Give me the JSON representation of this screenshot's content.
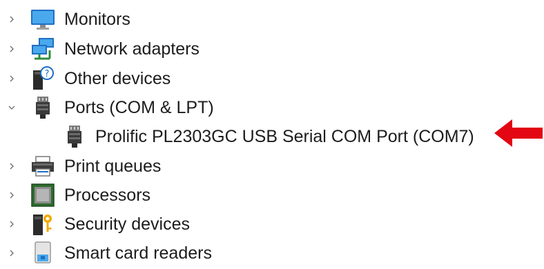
{
  "tree": {
    "items": [
      {
        "label": "Monitors",
        "expanded": false,
        "icon": "monitor-icon"
      },
      {
        "label": "Network adapters",
        "expanded": false,
        "icon": "network-adapter-icon"
      },
      {
        "label": "Other devices",
        "expanded": false,
        "icon": "unknown-device-icon"
      },
      {
        "label": "Ports (COM & LPT)",
        "expanded": true,
        "icon": "port-connector-icon"
      },
      {
        "label": "Prolific PL2303GC USB Serial COM Port (COM7)",
        "child": true,
        "icon": "port-connector-icon"
      },
      {
        "label": "Print queues",
        "expanded": false,
        "icon": "printer-icon"
      },
      {
        "label": "Processors",
        "expanded": false,
        "icon": "processor-icon"
      },
      {
        "label": "Security devices",
        "expanded": false,
        "icon": "security-device-icon"
      },
      {
        "label": "Smart card readers",
        "expanded": false,
        "icon": "smart-card-reader-icon"
      }
    ]
  },
  "annotation": {
    "arrow_color": "#e30613",
    "icon": "red-arrow-icon"
  },
  "colors": {
    "chevron": "#6b6b6b",
    "text": "#1c1c1c"
  }
}
